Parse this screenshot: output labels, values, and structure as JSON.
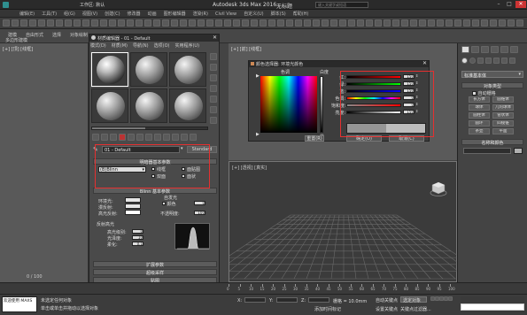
{
  "window": {
    "title": "Autodesk 3ds Max 2016",
    "file": "无标题",
    "workspace_label": "工作区: 默认",
    "search_placeholder": "键入关键字或短语"
  },
  "menubar": {
    "items": [
      "编辑(E)",
      "工具(T)",
      "组(G)",
      "视图(V)",
      "创建(C)",
      "修改器",
      "动画",
      "图形编辑器",
      "渲染(R)",
      "Civil View",
      "自定义(U)",
      "脚本(S)",
      "帮助(H)"
    ]
  },
  "ribbon": {
    "tabs": [
      "建模",
      "自由形式",
      "选择",
      "对象绘制"
    ],
    "sub_label": "多边形建模"
  },
  "left_viewport": {
    "label": "[+] [顶] [线框]",
    "ruler": "0 / 100"
  },
  "top_viewport": {
    "label": "[+] [前] [线框]"
  },
  "viewport": {
    "label": "[+] [透视] [真实]"
  },
  "material_editor": {
    "title": "材质编辑器 - 01 - Default",
    "menu": [
      "模式(D)",
      "材质(M)",
      "导航(N)",
      "选项(O)",
      "实用程序(U)"
    ],
    "material_name": "01 - Default",
    "type_label": "Standard",
    "basic_params_title": "明暗器基本参数",
    "shader": "(B)Blinn",
    "options": [
      "线框",
      "双面",
      "面贴图",
      "面状"
    ],
    "blinn_title": "Blinn 基本参数",
    "ambient": "环境光:",
    "diffuse": "漫反射:",
    "specular": "高光反射:",
    "self_illum": "自发光",
    "color_label": "颜色",
    "color_value": "0",
    "opacity_label": "不透明度:",
    "opacity_value": "100",
    "reflect_title": "反射高光",
    "spec_level_label": "高光级别:",
    "spec_level": "0",
    "gloss_label": "光泽度:",
    "gloss": "10",
    "soften_label": "柔化:",
    "soften": "0.1",
    "rollouts": [
      "扩展参数",
      "超级采样",
      "贴图",
      "mental ray 连接"
    ]
  },
  "color_picker": {
    "title": "颜色选择器: 环境光颜色",
    "hue_label": "色调",
    "white_label": "白度",
    "black_label": "黑",
    "channels": [
      {
        "label": "红:",
        "value": "150"
      },
      {
        "label": "绿:",
        "value": "150"
      },
      {
        "label": "蓝:",
        "value": "150"
      },
      {
        "label": "色调:",
        "value": "0"
      },
      {
        "label": "饱和度:",
        "value": "0"
      },
      {
        "label": "亮度:",
        "value": "150"
      }
    ],
    "reset": "重置(R)",
    "ok": "确定(O)",
    "cancel": "取消(C)"
  },
  "command_panel": {
    "category": "标准基本体",
    "object_type": "对象类型",
    "autogrid": "自动栅格",
    "buttons": [
      "长方体",
      "圆锥体",
      "球体",
      "几何球体",
      "圆柱体",
      "管状体",
      "圆环",
      "四棱锥",
      "茶壶",
      "平面"
    ],
    "name_color": "名称和颜色"
  },
  "timeline": {
    "ticks": [
      "0",
      "5",
      "10",
      "15",
      "20",
      "25",
      "30",
      "35",
      "40",
      "45",
      "50",
      "55",
      "60",
      "65",
      "70",
      "75",
      "80",
      "85",
      "90",
      "95",
      "100"
    ]
  },
  "statusbar": {
    "welcome": "欢迎使用 MAXS",
    "msg1": "未选定任何对象",
    "msg2": "单击或单击并拖动以选择对象",
    "x": "X:",
    "y": "Y:",
    "z": "Z:",
    "grid": "栅格 = 10.0mm",
    "add_time_tag": "添加时间标记",
    "auto_key": "自动关键点",
    "set_key": "设置关键点",
    "key_filter": "关键点过滤器...",
    "selected": "选定对象"
  }
}
